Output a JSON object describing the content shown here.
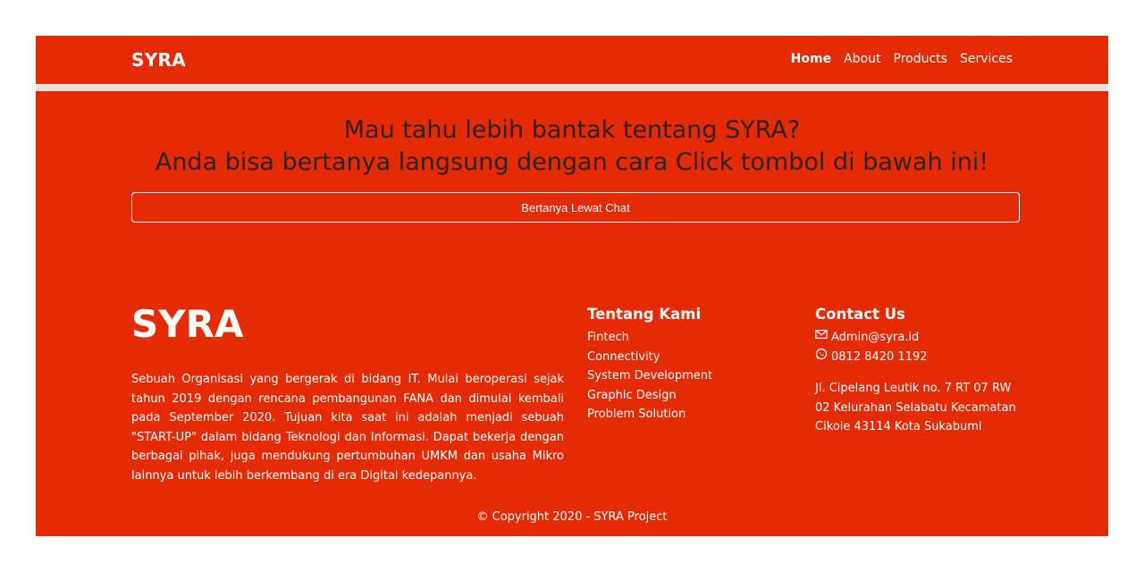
{
  "navbar": {
    "brand": "SYRA",
    "items": [
      {
        "label": "Home"
      },
      {
        "label": "About"
      },
      {
        "label": "Products"
      },
      {
        "label": "Services"
      }
    ]
  },
  "cta": {
    "line1": "Mau tahu lebih bantak tentang SYRA?",
    "line2": "Anda bisa bertanya langsung dengan cara Click tombol di bawah ini!",
    "button_label": "Bertanya Lewat Chat"
  },
  "footer": {
    "logo": "SYRA",
    "description": "Sebuah Organisasi yang bergerak di bidang IT. Mulai beroperasi sejak tahun 2019 dengan rencana pembangunan FANA dan dimulai kembali pada September 2020. Tujuan kita saat ini adalah menjadi sebuah \"START-UP\" dalam bidang Teknologi dan Informasi. Dapat bekerja dengan berbagai pihak, juga mendukung pertumbuhan UMKM dan usaha Mikro lainnya untuk lebih berkembang di era Digital kedepannya.",
    "about": {
      "heading": "Tentang Kami",
      "links": [
        "Fintech",
        "Connectivity",
        "System Development",
        "Graphic Design",
        "Problem Solution"
      ]
    },
    "contact": {
      "heading": "Contact Us",
      "email": "Admin@syra.id",
      "phone": "0812 8420 1192",
      "email_icon": "envelope-icon",
      "phone_icon": "whatsapp-icon",
      "address": "Jl. Cipelang Leutik no. 7 RT 07 RW 02 Kelurahan Selabatu Kecamatan Cikole 43114 Kota Sukabumi"
    },
    "copyright": "© Copyright 2020 - SYRA Project"
  },
  "colors": {
    "brand_red": "#e52a06",
    "divider": "#e8e1e1",
    "heading_dark": "#2b2424"
  }
}
